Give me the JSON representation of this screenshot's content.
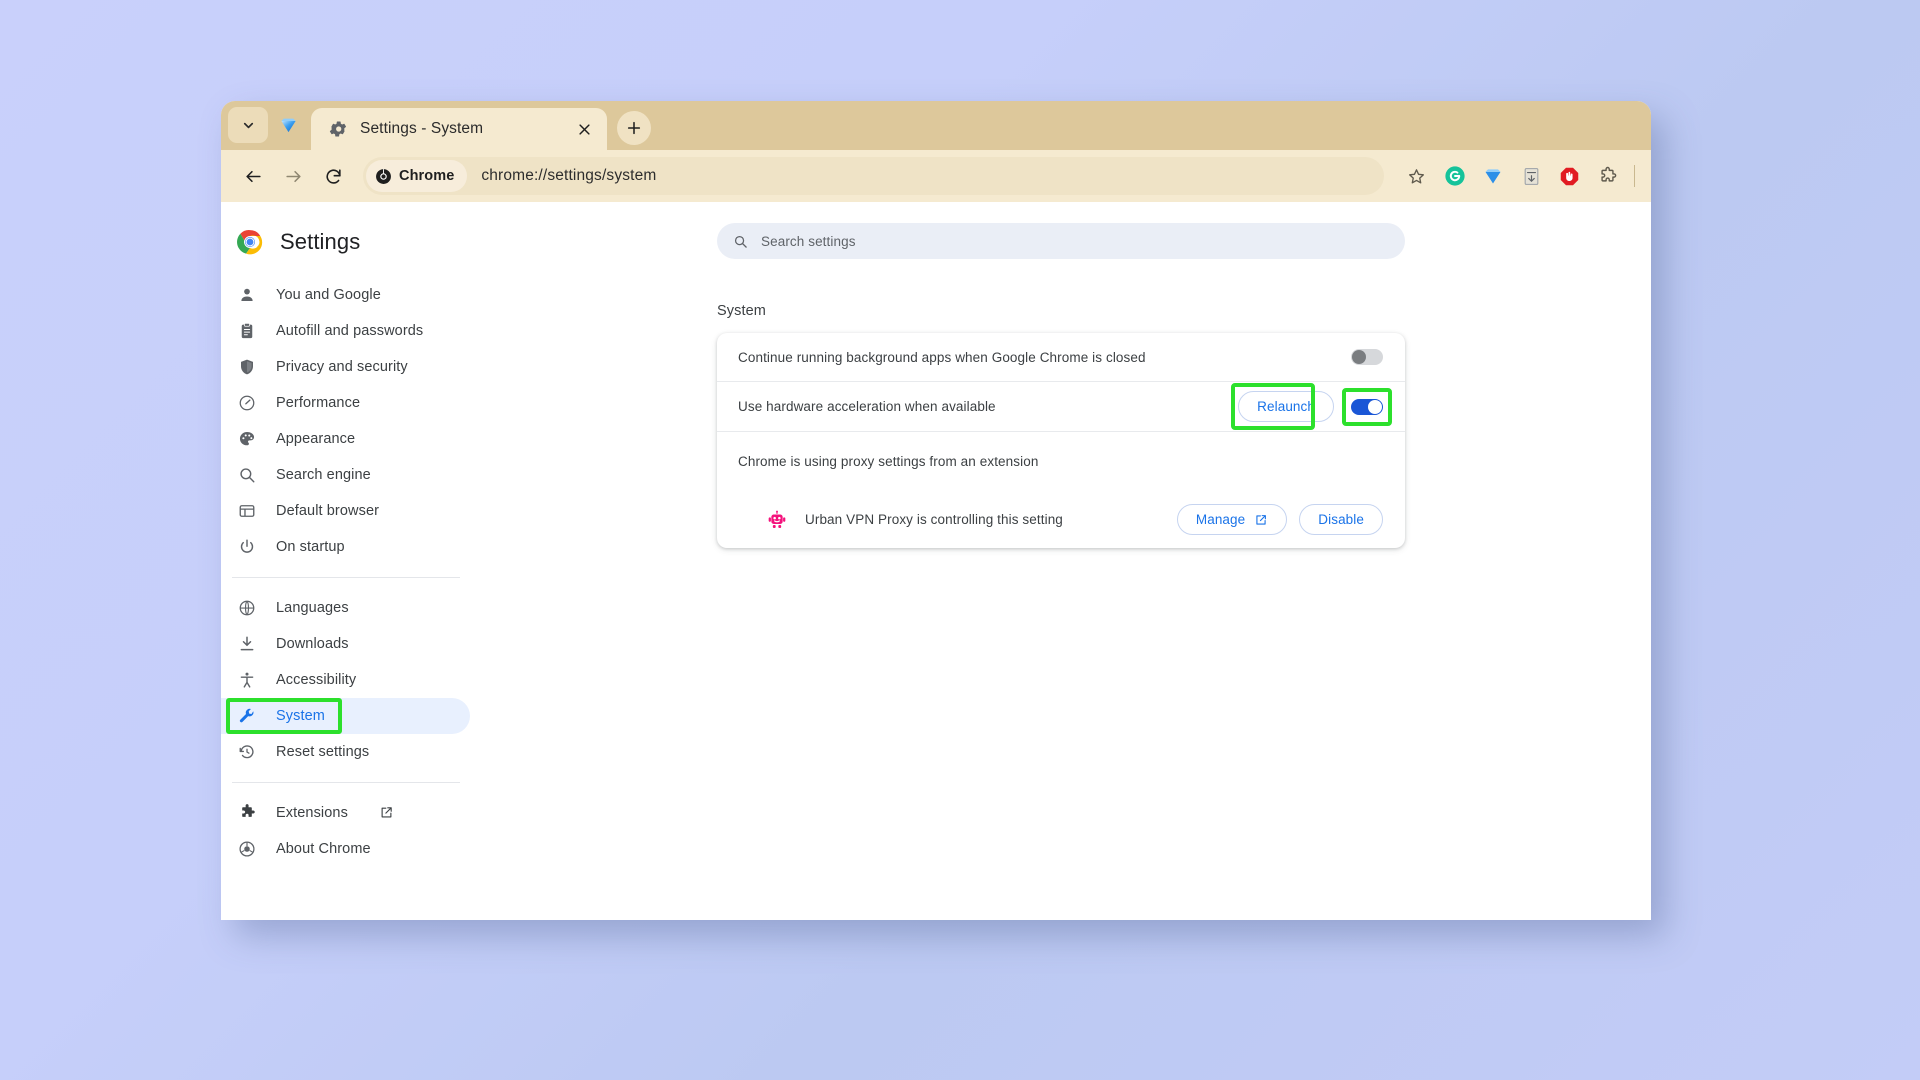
{
  "window": {
    "tab": {
      "title": "Settings - System",
      "favicon": "gear-icon",
      "close": "×",
      "new_tab": "+"
    },
    "tab_controls": {
      "tab_list_chevron": "chevron-down-icon",
      "diamond": "diamond-icon"
    },
    "toolbar": {
      "back": "back-arrow-icon",
      "forward": "forward-arrow-icon",
      "reload": "reload-icon",
      "chip_label": "Chrome",
      "chip_icon": "chrome-logo-icon",
      "url": "chrome://settings/system",
      "bookmark": "star-icon",
      "extensions": [
        {
          "name": "grammarly-icon",
          "label": "G",
          "color": "#15c39a"
        },
        {
          "name": "diamond-icon",
          "label": "",
          "color": "#2b8fe8"
        },
        {
          "name": "grey-box-icon",
          "label": "",
          "color": "#9aa0a6"
        },
        {
          "name": "adblock-icon",
          "label": "",
          "color": "#e11b22"
        },
        {
          "name": "puzzle-piece-icon",
          "label": "",
          "color": "#5f6368"
        }
      ]
    }
  },
  "sidebar": {
    "title": "Settings",
    "logo": "chrome-logo-icon",
    "groups": [
      {
        "items": [
          {
            "label": "You and Google",
            "icon": "person-icon",
            "selected": false
          },
          {
            "label": "Autofill and passwords",
            "icon": "clipboard-icon",
            "selected": false
          },
          {
            "label": "Privacy and security",
            "icon": "shield-icon",
            "selected": false
          },
          {
            "label": "Performance",
            "icon": "speedometer-icon",
            "selected": false
          },
          {
            "label": "Appearance",
            "icon": "palette-icon",
            "selected": false
          },
          {
            "label": "Search engine",
            "icon": "search-icon",
            "selected": false
          },
          {
            "label": "Default browser",
            "icon": "browser-window-icon",
            "selected": false
          },
          {
            "label": "On startup",
            "icon": "power-icon",
            "selected": false
          }
        ]
      },
      {
        "items": [
          {
            "label": "Languages",
            "icon": "globe-icon",
            "selected": false
          },
          {
            "label": "Downloads",
            "icon": "download-icon",
            "selected": false
          },
          {
            "label": "Accessibility",
            "icon": "accessibility-icon",
            "selected": false
          },
          {
            "label": "System",
            "icon": "wrench-icon",
            "selected": true
          },
          {
            "label": "Reset settings",
            "icon": "history-restore-icon",
            "selected": false
          }
        ]
      },
      {
        "items": [
          {
            "label": "Extensions",
            "icon": "puzzle-piece-icon",
            "selected": false,
            "external": "external-link-icon"
          },
          {
            "label": "About Chrome",
            "icon": "chrome-outline-icon",
            "selected": false
          }
        ]
      }
    ]
  },
  "main": {
    "search": {
      "placeholder": "Search settings",
      "icon": "search-icon"
    },
    "section_title": "System",
    "rows": [
      {
        "label": "Continue running background apps when Google Chrome is closed",
        "control": "toggle",
        "state": "off"
      },
      {
        "label": "Use hardware acceleration when available",
        "control": "relaunch+toggle",
        "button_label": "Relaunch",
        "state": "on"
      }
    ],
    "proxy": {
      "heading": "Chrome is using proxy settings from an extension",
      "extension_name": "Urban VPN Proxy is controlling this setting",
      "extension_icon": "robot-icon",
      "manage_label": "Manage",
      "manage_icon": "external-link-icon",
      "disable_label": "Disable"
    }
  },
  "highlights": {
    "color": "#2ce02c",
    "targets": [
      "sidebar-item-system",
      "relaunch-button",
      "hardware-acceleration-toggle"
    ]
  }
}
